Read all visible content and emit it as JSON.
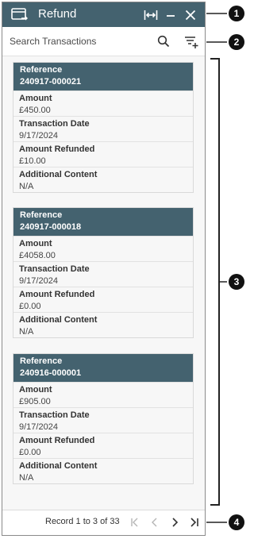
{
  "window": {
    "title": "Refund",
    "buttons": [
      "expand-icon",
      "minimize-icon",
      "close-icon"
    ],
    "header_color": "#44626f"
  },
  "search": {
    "placeholder": "Search Transactions",
    "value": ""
  },
  "transactions": [
    {
      "reference_label": "Reference",
      "reference": "240917-000021",
      "amount_label": "Amount",
      "amount": "£450.00",
      "date_label": "Transaction Date",
      "date": "9/17/2024",
      "refunded_label": "Amount Refunded",
      "refunded": "£10.00",
      "additional_label": "Additional Content",
      "additional": "N/A"
    },
    {
      "reference_label": "Reference",
      "reference": "240917-000018",
      "amount_label": "Amount",
      "amount": "£4058.00",
      "date_label": "Transaction Date",
      "date": "9/17/2024",
      "refunded_label": "Amount Refunded",
      "refunded": "£0.00",
      "additional_label": "Additional Content",
      "additional": "N/A"
    },
    {
      "reference_label": "Reference",
      "reference": "240916-000001",
      "amount_label": "Amount",
      "amount": "£905.00",
      "date_label": "Transaction Date",
      "date": "9/17/2024",
      "refunded_label": "Amount Refunded",
      "refunded": "£0.00",
      "additional_label": "Additional Content",
      "additional": "N/A"
    }
  ],
  "pagination": {
    "record_text": "Record 1 to 3 of 33"
  },
  "callouts": [
    "1",
    "2",
    "3",
    "4"
  ]
}
